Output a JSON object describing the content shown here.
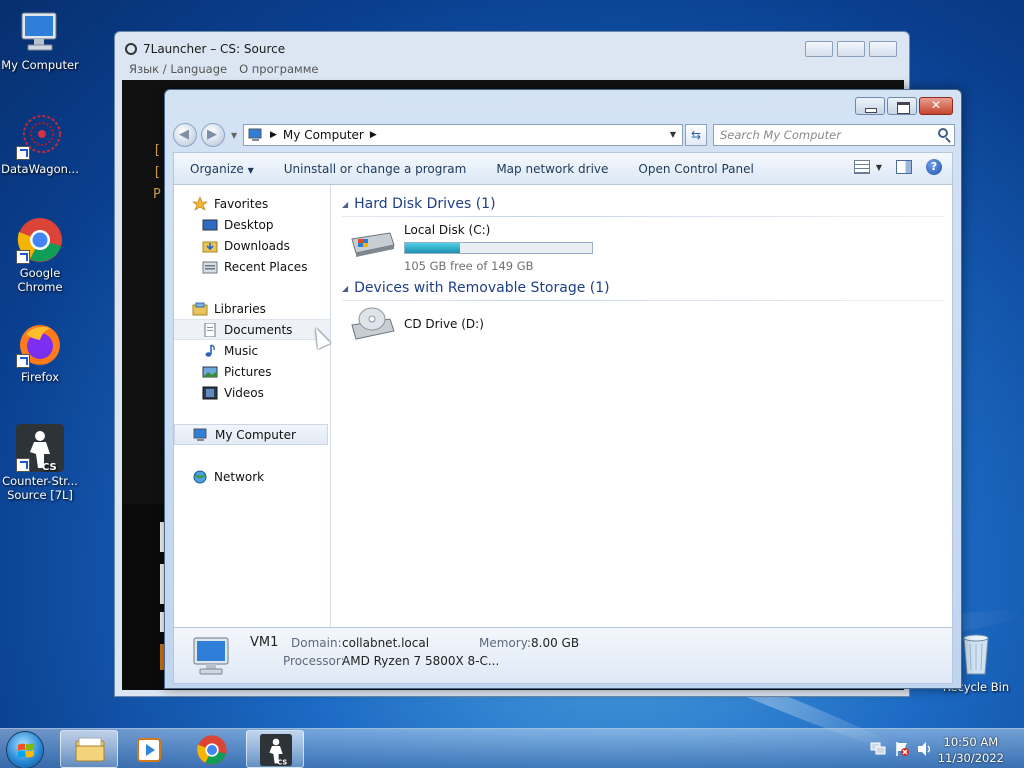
{
  "desktop": {
    "icons": [
      {
        "label": "My Computer"
      },
      {
        "label": "DataWagon..."
      },
      {
        "label": "Google Chrome"
      },
      {
        "label": "Firefox"
      },
      {
        "label": "Counter-Str... Source [7L]"
      },
      {
        "label": "Recycle Bin"
      }
    ]
  },
  "launcher": {
    "title": "7Launcher – CS: Source",
    "menu": [
      "Язык / Language",
      "О программе"
    ],
    "console_lines": [
      "[",
      "[",
      "P"
    ]
  },
  "explorer": {
    "address": {
      "crumb": "My Computer"
    },
    "search_placeholder": "Search My Computer",
    "toolbar": {
      "organize": "Organize",
      "uninstall": "Uninstall or change a program",
      "map_drive": "Map network drive",
      "control_panel": "Open Control Panel"
    },
    "nav": {
      "favorites": "Favorites",
      "desktop": "Desktop",
      "downloads": "Downloads",
      "recent": "Recent Places",
      "libraries": "Libraries",
      "documents": "Documents",
      "music": "Music",
      "pictures": "Pictures",
      "videos": "Videos",
      "computer": "My Computer",
      "network": "Network"
    },
    "groups": {
      "hdd": "Hard Disk Drives (1)",
      "removable": "Devices with Removable Storage (1)"
    },
    "drives": {
      "c": {
        "name": "Local Disk (C:)",
        "free": "105 GB free of 149 GB",
        "used_fraction": 0.295
      },
      "d": {
        "name": "CD Drive (D:)"
      }
    },
    "details": {
      "name": "VM1",
      "domain_label": "Domain:",
      "domain": "collabnet.local",
      "memory_label": "Memory:",
      "memory": "8.00 GB",
      "processor_label": "Processor:",
      "processor": "AMD Ryzen 7 5800X 8-C..."
    }
  },
  "taskbar": {
    "time": "10:50 AM",
    "date": "11/30/2022"
  }
}
